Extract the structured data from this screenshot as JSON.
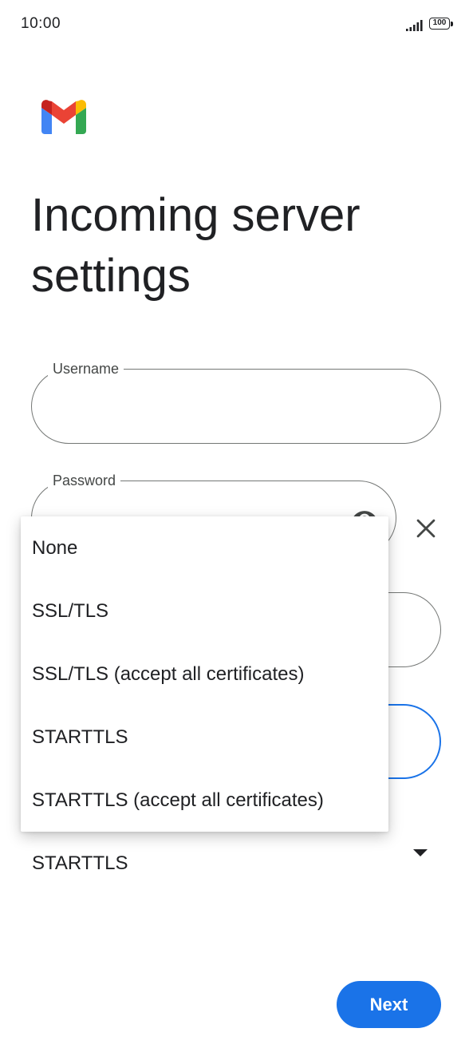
{
  "status_bar": {
    "time": "10:00",
    "battery": "100"
  },
  "page": {
    "title": "Incoming server settings"
  },
  "fields": {
    "username_label": "Username",
    "password_label": "Password"
  },
  "security": {
    "selected_value": "STARTTLS"
  },
  "dropdown": {
    "options": [
      "None",
      "SSL/TLS",
      "SSL/TLS (accept all certificates)",
      "STARTTLS",
      "STARTTLS (accept all certificates)"
    ]
  },
  "actions": {
    "next_label": "Next"
  },
  "colors": {
    "accent": "#1a73e8",
    "outline": "#747775",
    "text": "#202124"
  },
  "icons": {
    "app_logo": "gmail-logo-icon",
    "signal": "signal-icon",
    "battery": "battery-icon",
    "password_toggle": "eye-icon",
    "clear": "close-icon",
    "dropdown": "dropdown-arrow-icon"
  }
}
